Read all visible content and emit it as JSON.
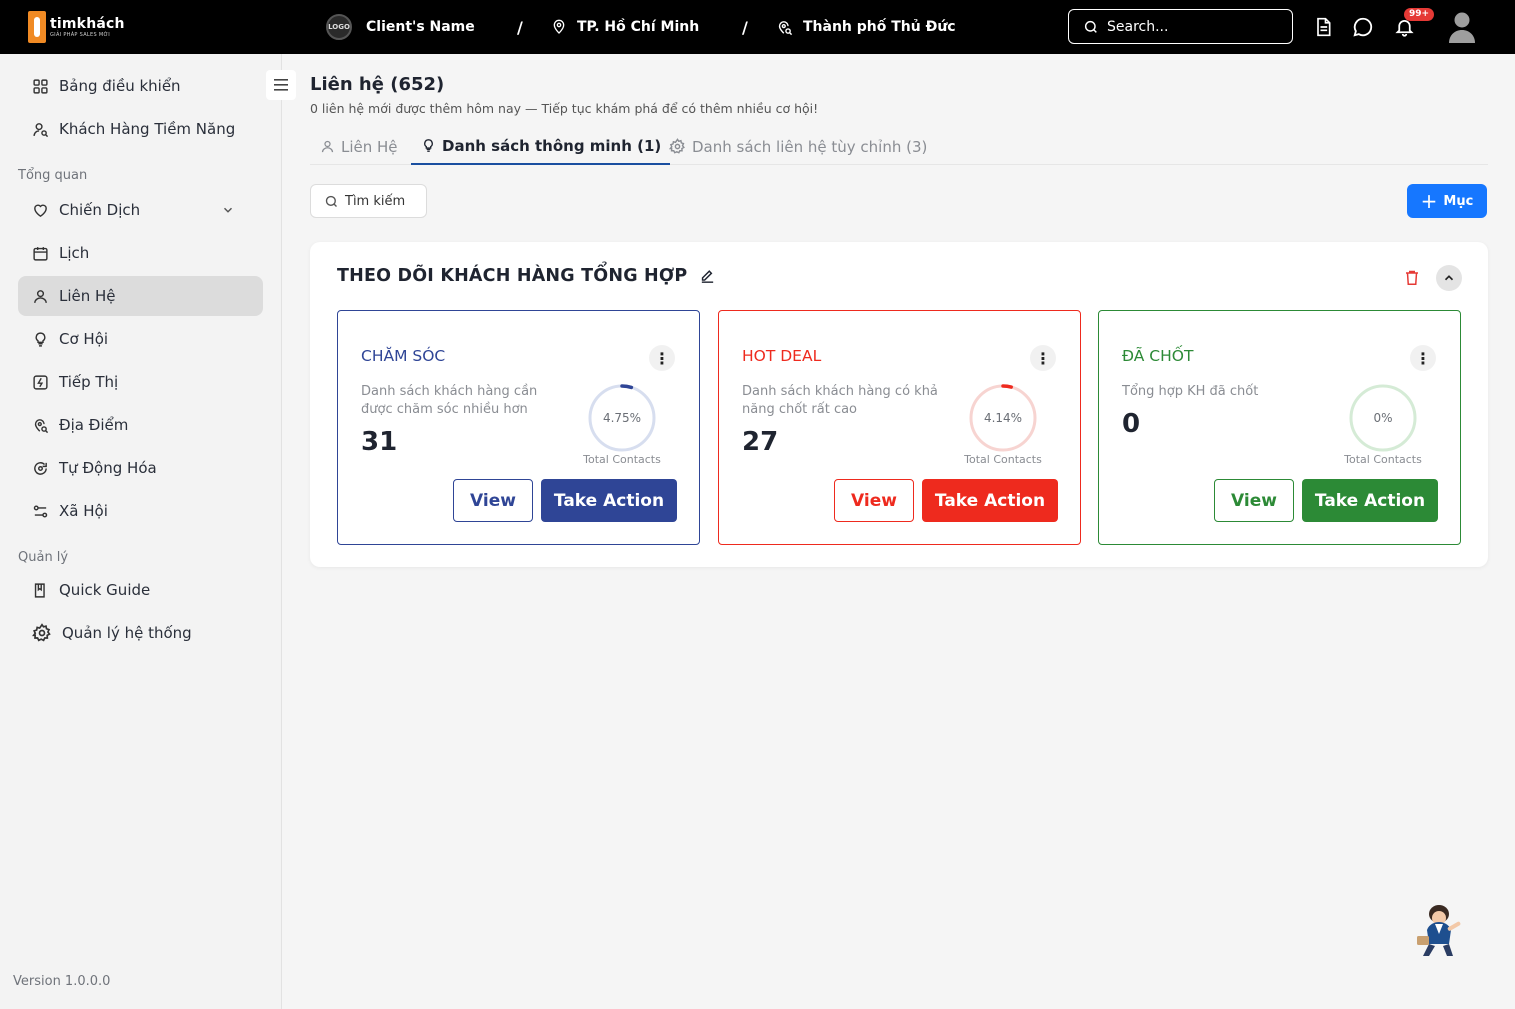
{
  "brand": {
    "name": "timkhách",
    "sub": "GIẢI PHÁP SALES MỚI"
  },
  "header": {
    "logo": "LOGO",
    "client": "Client's Name",
    "sep": "/",
    "city": "TP. Hồ Chí Minh",
    "district": "Thành phố Thủ Đức",
    "search_placeholder": "Search...",
    "notif_badge": "99+"
  },
  "sidebar": {
    "top_items": [
      {
        "label": "Bảng điều khiển",
        "icon": "dashboard-icon"
      },
      {
        "label": "Khách Hàng Tiềm Năng",
        "icon": "user-search-icon"
      }
    ],
    "section_overview": "Tổng quan",
    "overview_items": [
      {
        "label": "Chiến Dịch",
        "icon": "heart-icon"
      },
      {
        "label": "Lịch",
        "icon": "calendar-icon"
      },
      {
        "label": "Liên Hệ",
        "icon": "user-icon"
      },
      {
        "label": "Cơ Hội",
        "icon": "bulb-icon"
      },
      {
        "label": "Tiếp Thị",
        "icon": "marketing-icon"
      },
      {
        "label": "Địa Điểm",
        "icon": "location-icon"
      },
      {
        "label": "Tự Động Hóa",
        "icon": "automation-icon"
      },
      {
        "label": "Xã Hội",
        "icon": "social-icon"
      }
    ],
    "section_manage": "Quản lý",
    "manage_items": [
      {
        "label": "Quick Guide",
        "icon": "book-icon"
      },
      {
        "label": "Quản lý hệ thống",
        "icon": "gear-icon"
      }
    ],
    "version": "Version 1.0.0.0"
  },
  "main": {
    "title": "Liên hệ (652)",
    "subtitle": "0 liên hệ mới được thêm hôm nay — Tiếp tục khám phá để có thêm nhiều cơ hội!",
    "tabs": [
      "Liên Hệ",
      "Danh sách thông minh (1)",
      "Danh sách liên hệ tùy chỉnh (3)"
    ],
    "search_label": "Tìm kiếm",
    "add_label": "Mục",
    "panel_title": "THEO DÕI KHÁCH HÀNG TỔNG HỢP"
  },
  "cards": [
    {
      "title": "CHĂM SÓC",
      "description": "Danh sách khách hàng cần được chăm sóc nhiều hơn",
      "count": "31",
      "percent_label": "4.75%",
      "percent": 4.75,
      "caption": "Total Contacts",
      "view_label": "View",
      "action_label": "Take Action",
      "color": "#2f4596",
      "ring_bg": "#d7deef"
    },
    {
      "title": "HOT DEAL",
      "description": "Danh sách khách hàng có khả năng chốt rất cao",
      "count": "27",
      "percent_label": "4.14%",
      "percent": 4.14,
      "caption": "Total Contacts",
      "view_label": "View",
      "action_label": "Take Action",
      "color": "#ee2a1e",
      "ring_bg": "#f7d4d1"
    },
    {
      "title": "ĐÃ CHỐT",
      "description": "Tổng hợp KH đã chốt",
      "count": "0",
      "percent_label": "0%",
      "percent": 0,
      "caption": "Total Contacts",
      "view_label": "View",
      "action_label": "Take Action",
      "color": "#2c8a36",
      "ring_bg": "#d5ebd6"
    }
  ]
}
